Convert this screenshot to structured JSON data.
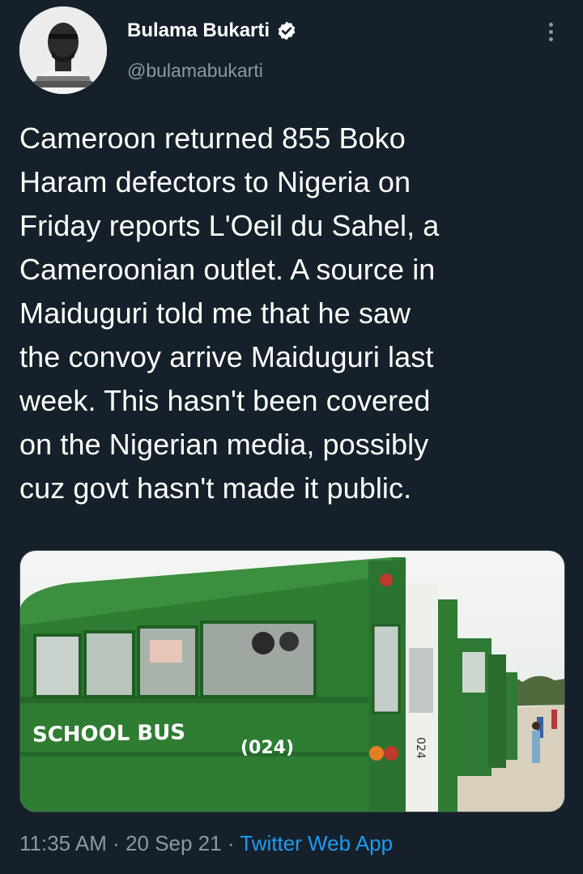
{
  "author": {
    "display_name": "Bulama Bukarti",
    "handle": "@bulamabukarti",
    "verified": true
  },
  "icons": {
    "verified": "verified-badge-icon",
    "more": "more-vertical-icon"
  },
  "tweet": {
    "text": "Cameroon returned 855 Boko\nHaram defectors to Nigeria on\nFriday reports L'Oeil du Sahel, a\nCameroonian outlet. A source in\nMaiduguri told me that he saw\nthe convoy arrive Maiduguri last\nweek. This hasn't been covered\non the Nigerian media, possibly\ncuz govt hasn't made it public."
  },
  "media": {
    "bus_label": "SCHOOL  BUS",
    "bus_number": "(024)",
    "rear_number": "024"
  },
  "meta": {
    "time": "11:35 AM",
    "separator": " · ",
    "date": "20 Sep 21",
    "source": "Twitter Web App"
  },
  "colors": {
    "background": "#15202b",
    "secondary_text": "#8b98a5",
    "link": "#1d9bf0",
    "bus_green": "#2e7d32"
  }
}
